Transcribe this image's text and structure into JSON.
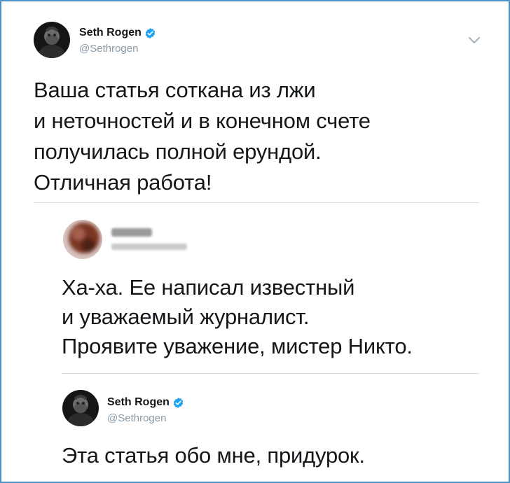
{
  "tweet1": {
    "author_name": "Seth Rogen",
    "author_handle": "@Sethrogen",
    "avatar_icon": "avatar-icon",
    "verified_icon": "verified-badge-icon",
    "menu_icon": "chevron-down-icon",
    "text": "Ваша статья соткана из лжи\nи неточностей и в конечном счете\nполучилась полной ерундой.\nОтличная работа!"
  },
  "tweet2": {
    "author_name": "",
    "author_handle": "",
    "avatar_icon": "blurred-avatar-icon",
    "text": "Ха-ха. Ее написал известный\nи уважаемый журналист.\nПроявите уважение, мистер Никто."
  },
  "tweet3": {
    "author_name": "Seth Rogen",
    "author_handle": "@Sethrogen",
    "avatar_icon": "avatar-icon",
    "verified_icon": "verified-badge-icon",
    "text": "Эта статья обо мне, придурок."
  },
  "colors": {
    "frame_border": "#4f93c4",
    "verified_blue": "#1da1f2",
    "handle_gray": "#8899a6",
    "text_dark": "#14171a",
    "divider": "#d6dce0"
  }
}
